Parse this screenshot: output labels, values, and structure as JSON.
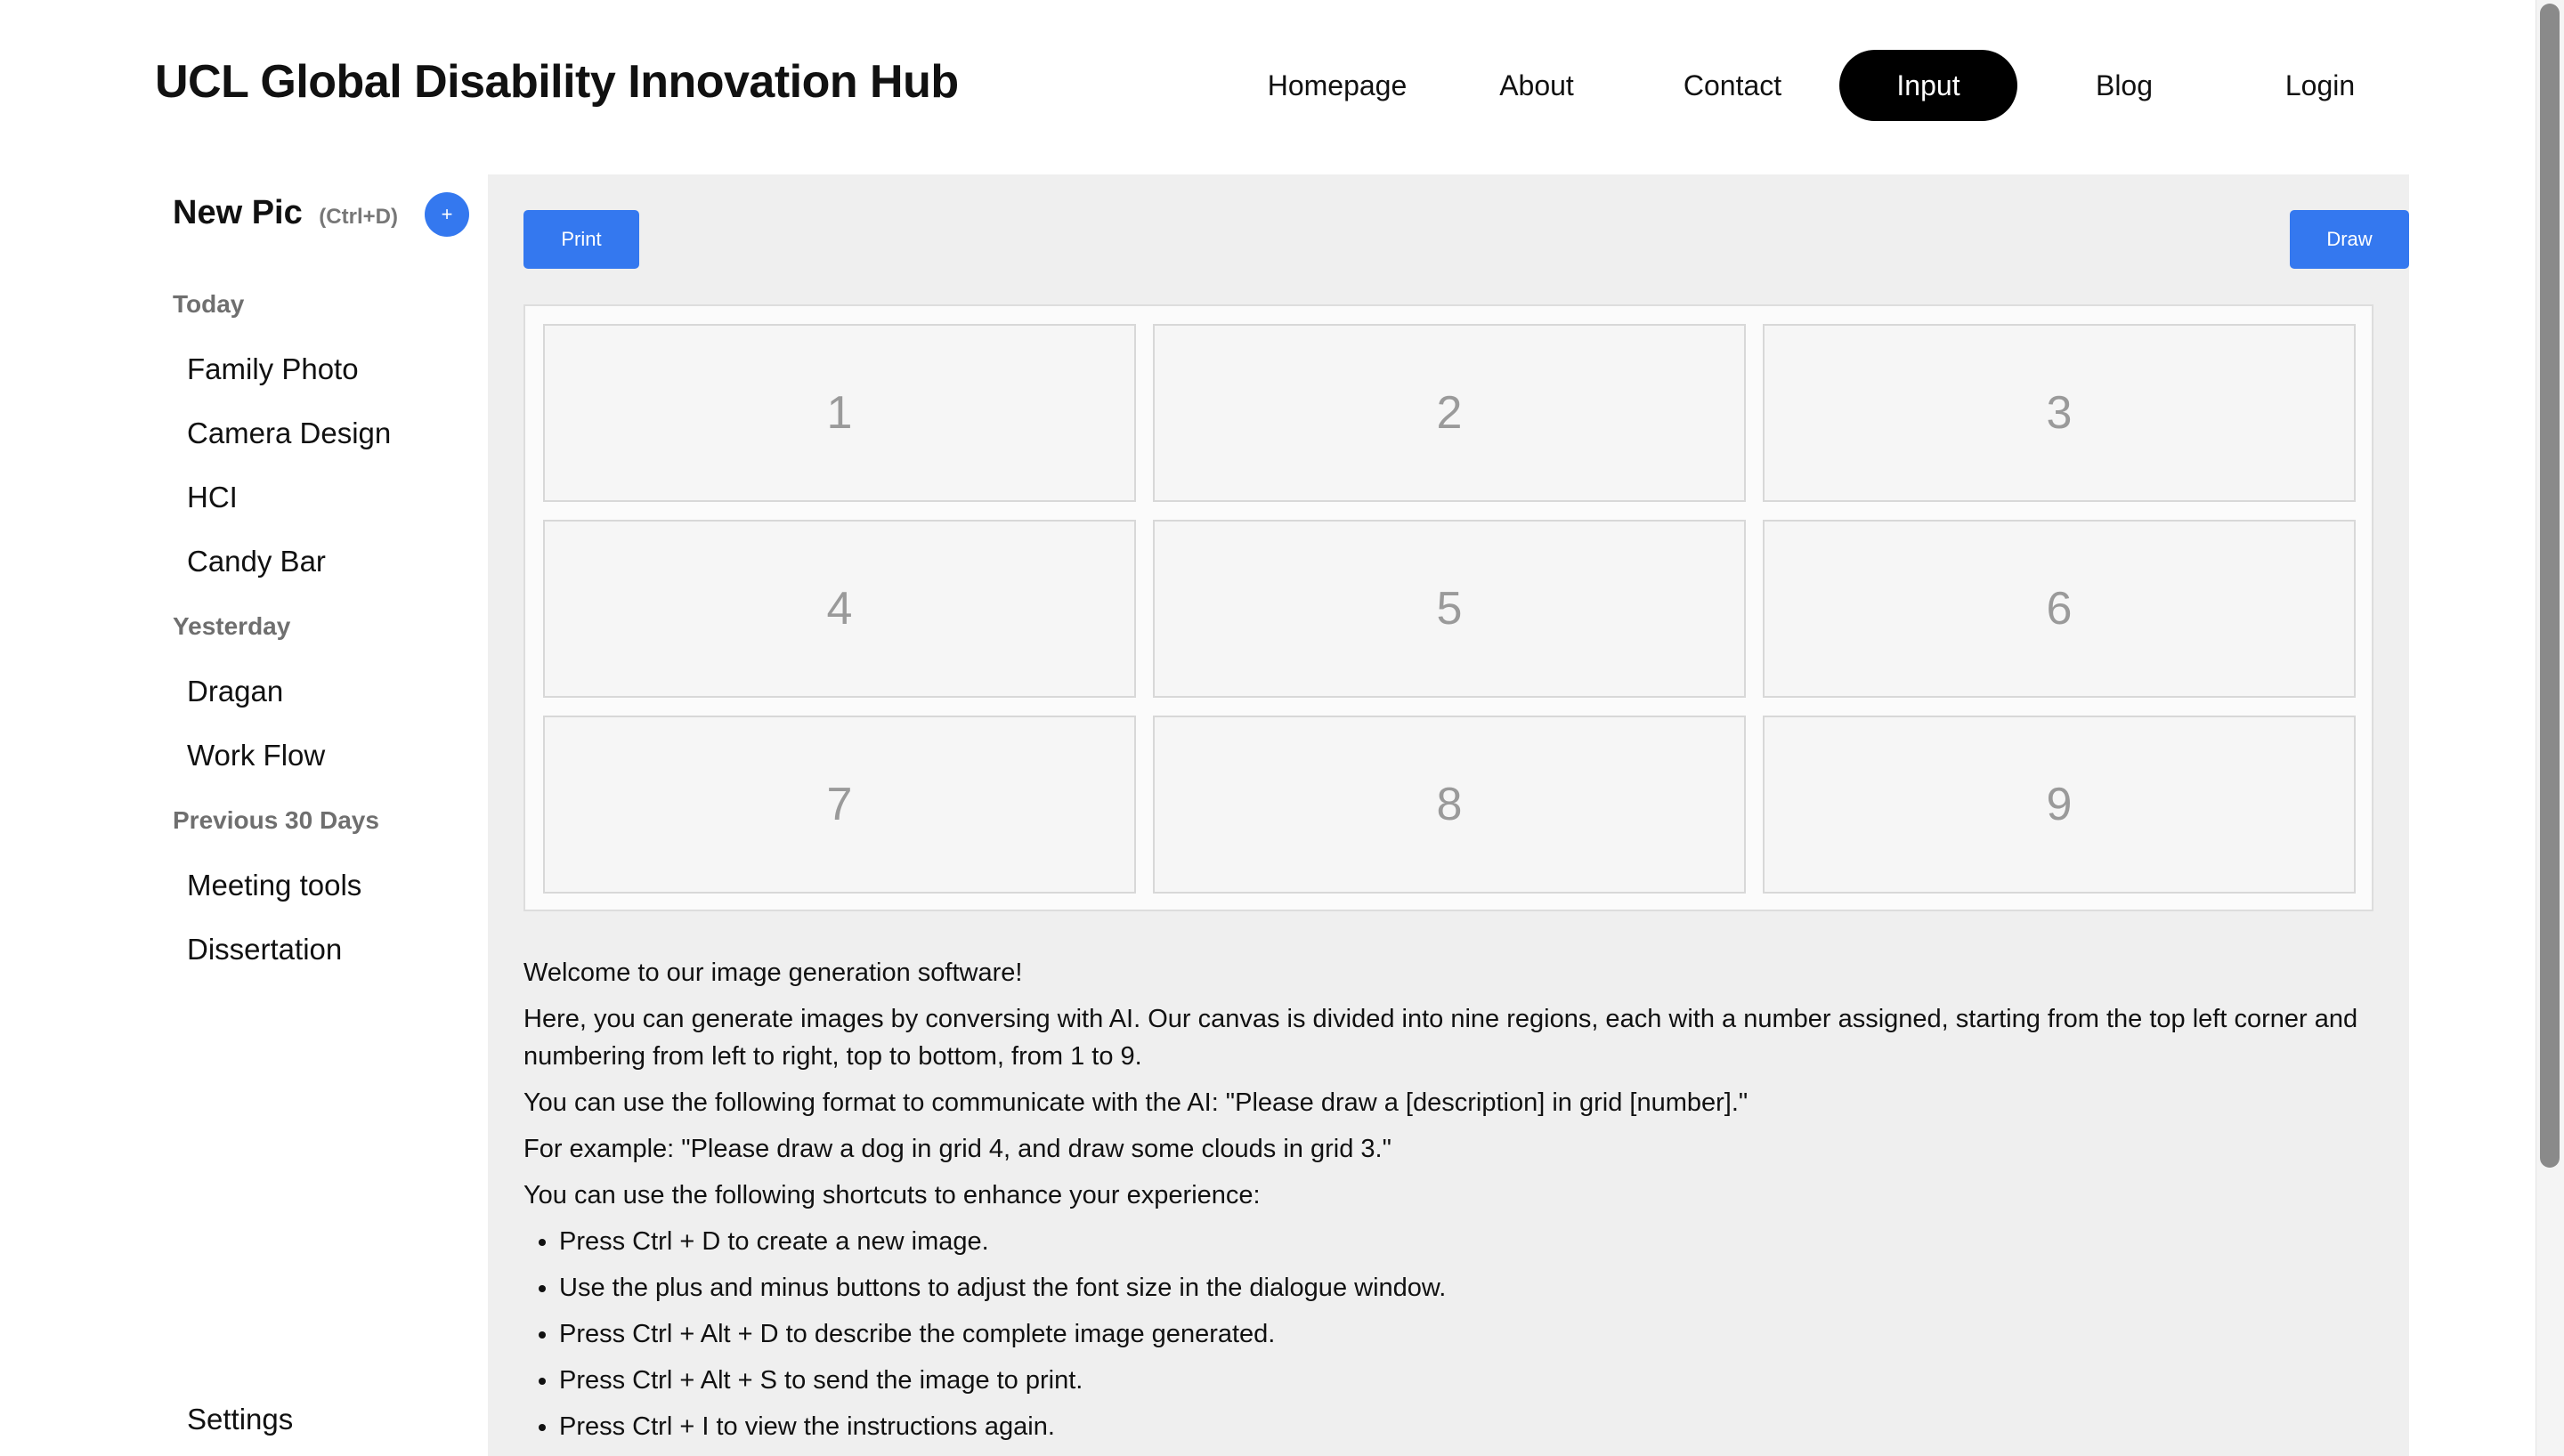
{
  "header": {
    "brand": "UCL Global Disability Innovation Hub",
    "nav": [
      {
        "label": "Homepage",
        "active": false
      },
      {
        "label": "About",
        "active": false
      },
      {
        "label": "Contact",
        "active": false
      },
      {
        "label": "Input",
        "active": true
      },
      {
        "label": "Blog",
        "active": false
      },
      {
        "label": "Login",
        "active": false
      }
    ]
  },
  "sidebar": {
    "new_pic_label": "New Pic",
    "new_pic_shortcut": "(Ctrl+D)",
    "add_button_label": "+",
    "sections": [
      {
        "label": "Today",
        "items": [
          "Family Photo",
          "Camera Design",
          "HCI",
          "Candy Bar"
        ]
      },
      {
        "label": "Yesterday",
        "items": [
          "Dragan",
          "Work Flow"
        ]
      },
      {
        "label": "Previous 30 Days",
        "items": [
          "Meeting tools",
          "Dissertation"
        ]
      }
    ],
    "settings_label": "Settings"
  },
  "toolbar": {
    "print_label": "Print",
    "draw_label": "Draw"
  },
  "grid": {
    "cells": [
      "1",
      "2",
      "3",
      "4",
      "5",
      "6",
      "7",
      "8",
      "9"
    ]
  },
  "instructions": {
    "paragraphs": [
      "Welcome to our image generation software!",
      "Here, you can generate images by conversing with AI. Our canvas is divided into nine regions, each with a number assigned, starting from the top left corner and numbering from left to right, top to bottom, from 1 to 9.",
      "You can use the following format to communicate with the AI: \"Please draw a [description] in grid [number].\"",
      "For example: \"Please draw a dog in grid 4, and draw some clouds in grid 3.\"",
      "You can use the following shortcuts to enhance your experience:"
    ],
    "shortcuts": [
      "Press Ctrl + D to create a new image.",
      "Use the plus and minus buttons to adjust the font size in the dialogue window.",
      "Press Ctrl + Alt + D to describe the complete image generated.",
      "Press Ctrl + Alt + S to send the image to print.",
      "Press Ctrl + I to view the instructions again."
    ]
  },
  "colors": {
    "accent": "#3478ef",
    "active_nav_bg": "#000000",
    "panel_bg": "#efefef"
  }
}
